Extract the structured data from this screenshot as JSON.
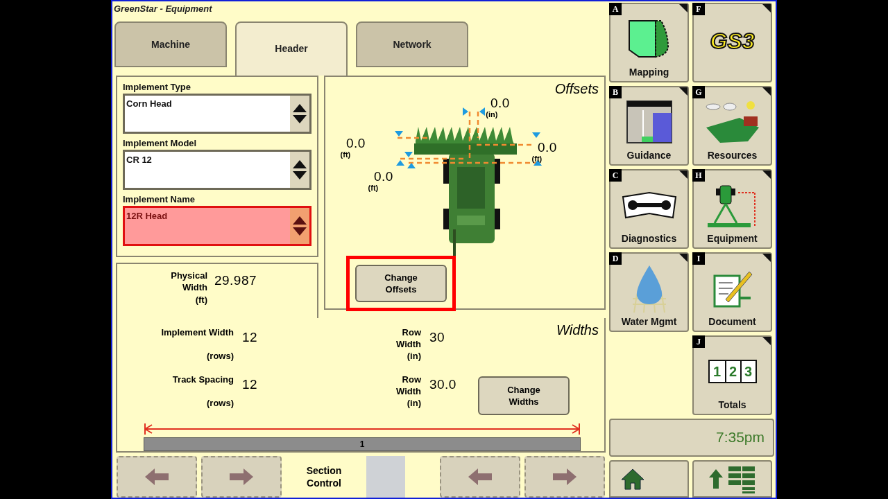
{
  "window": {
    "title": "GreenStar - Equipment"
  },
  "tabs": [
    {
      "label": "Machine",
      "selected": false
    },
    {
      "label": "Header",
      "selected": true
    },
    {
      "label": "Network",
      "selected": false
    }
  ],
  "fields": [
    {
      "label": "Implement Type",
      "value": "Corn Head",
      "invalid": false
    },
    {
      "label": "Implement Model",
      "value": "CR 12",
      "invalid": false
    },
    {
      "label": "Implement Name",
      "value": "12R Head",
      "invalid": true
    }
  ],
  "physical_width": {
    "label": "Physical Width",
    "value": "29.987",
    "unit": "(ft)"
  },
  "offsets": {
    "title": "Offsets",
    "button": "Change Offsets",
    "highlighted": true,
    "values": [
      {
        "value": "0.0",
        "unit": "(in)"
      },
      {
        "value": "0.0",
        "unit": "(ft)"
      },
      {
        "value": "0.0",
        "unit": "(ft)"
      },
      {
        "value": "0.0",
        "unit": "(ft)"
      }
    ]
  },
  "widths": {
    "title": "Widths",
    "button": "Change Widths",
    "section_bar": "1",
    "items": [
      {
        "label": "Implement Width",
        "value": "12",
        "unit": "(rows)"
      },
      {
        "label": "Row Width",
        "value": "30",
        "unit": "(in)"
      },
      {
        "label": "Track Spacing",
        "value": "12",
        "unit": "(rows)"
      },
      {
        "label": "Row Width",
        "value": "30.0",
        "unit": "(in)"
      }
    ]
  },
  "section_control": {
    "label": "Section Control"
  },
  "shortcut_columns": [
    [
      {
        "letter": "A",
        "label": "Mapping",
        "kind": "mapping"
      },
      {
        "letter": "B",
        "label": "Guidance",
        "kind": "guidance"
      },
      {
        "letter": "C",
        "label": "Diagnostics",
        "kind": "diagnostics"
      },
      {
        "letter": "D",
        "label": "Water Mgmt",
        "kind": "water"
      }
    ],
    [
      {
        "letter": "F",
        "label": "GS3",
        "kind": "logo"
      },
      {
        "letter": "G",
        "label": "Resources",
        "kind": "resources"
      },
      {
        "letter": "H",
        "label": "Equipment",
        "kind": "equipment"
      },
      {
        "letter": "I",
        "label": "Document",
        "kind": "document"
      },
      {
        "letter": "J",
        "label": "Totals",
        "kind": "totals",
        "counter": [
          "1",
          "2",
          "3"
        ]
      }
    ]
  ],
  "clock": "7:35pm"
}
